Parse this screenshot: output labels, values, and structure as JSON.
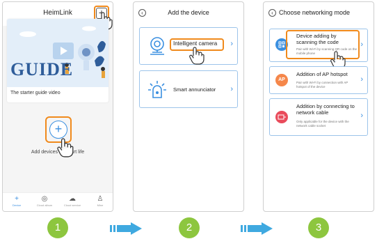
{
  "screen1": {
    "title": "HeimLink",
    "add_button": "+",
    "guide_word": "GUIDE",
    "guide_caption": "The starter guide video",
    "add_device_button": "+",
    "add_prompt": "Add devices to smart life",
    "tabs": [
      {
        "label": "Device",
        "icon": "plus-icon"
      },
      {
        "label": "Cloud album",
        "icon": "album-icon"
      },
      {
        "label": "Cloud service",
        "icon": "cloud-icon"
      },
      {
        "label": "Mine",
        "icon": "person-icon"
      }
    ]
  },
  "screen2": {
    "title": "Add the device",
    "back": "‹",
    "devices": [
      {
        "label": "Intelligent camera",
        "icon": "camera-icon"
      },
      {
        "label": "Smart annunciator",
        "icon": "alarm-icon"
      }
    ],
    "chevron": "›"
  },
  "screen3": {
    "title": "Choose networking mode",
    "back": "‹",
    "options": [
      {
        "title": "Device adding by scanning the code",
        "subtitle": "Pair with Wi-Fi by scanning QR code on the mobile phone",
        "icon": "qr-code-icon",
        "color": "#3a8fe0"
      },
      {
        "title": "Addition of AP hotspot",
        "subtitle": "Pair with Wi-Fi by connection with AP hotspot of the device",
        "icon_text": "AP",
        "color": "#f5874a"
      },
      {
        "title": "Addition by connecting to network cable",
        "subtitle": "Only applicable for the device with the network cable socket",
        "icon": "network-cable-icon",
        "color": "#e94b5b"
      }
    ],
    "chevron": "›"
  },
  "steps": [
    "1",
    "2",
    "3"
  ],
  "colors": {
    "accent": "#3a8fe0",
    "highlight": "#f08a1c",
    "step": "#8dc63f",
    "arrow": "#3fa9e0"
  }
}
